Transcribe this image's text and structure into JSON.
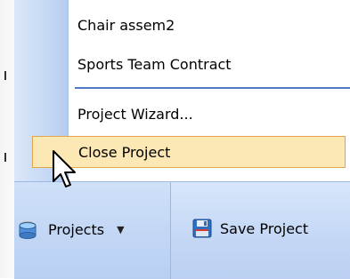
{
  "menu": {
    "items": [
      {
        "label": "Chair assem2"
      },
      {
        "label": "Sports Team Contract"
      },
      {
        "label": "Project Wizard..."
      },
      {
        "label": "Close Project"
      }
    ]
  },
  "toolbar": {
    "projects_label": "Projects",
    "save_label": "Save Project"
  },
  "colors": {
    "highlight_bg": "#fce8b4",
    "highlight_border": "#e2a64a",
    "separator": "#4f79c4",
    "toolbar_bg": "#c3d7f5"
  },
  "icons": {
    "projects": "projects-folder-icon",
    "save": "floppy-disk-icon",
    "dropdown": "chevron-down-icon",
    "cursor": "mouse-pointer-icon"
  }
}
